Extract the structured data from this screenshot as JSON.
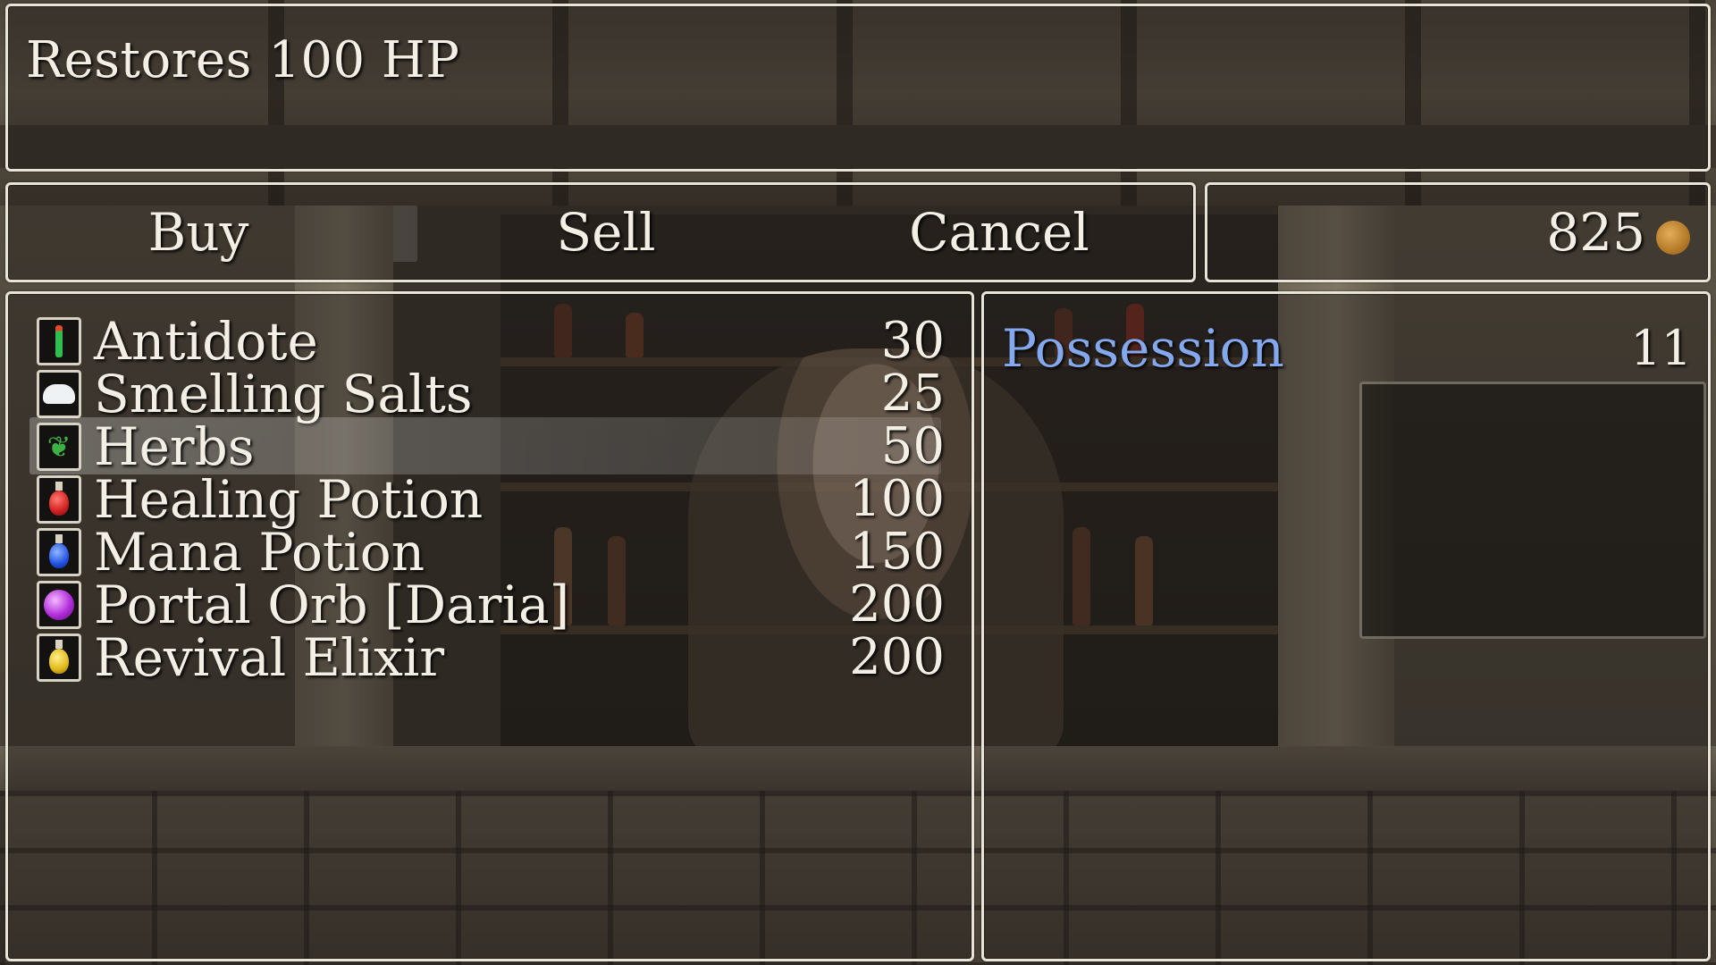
{
  "help": {
    "text": "Restores 100 HP"
  },
  "commands": [
    {
      "id": "buy",
      "label": "Buy",
      "active": true
    },
    {
      "id": "sell",
      "label": "Sell",
      "active": false
    },
    {
      "id": "cancel",
      "label": "Cancel",
      "active": false
    }
  ],
  "gold": {
    "value": "825",
    "icon": "gold-coin-icon"
  },
  "items": [
    {
      "name": "Antidote",
      "price": "30",
      "icon": "antidote-vial-icon"
    },
    {
      "name": "Smelling Salts",
      "price": "25",
      "icon": "smelling-salts-icon"
    },
    {
      "name": "Herbs",
      "price": "50",
      "icon": "herb-leaf-icon"
    },
    {
      "name": "Healing Potion",
      "price": "100",
      "icon": "red-potion-icon"
    },
    {
      "name": "Mana Potion",
      "price": "150",
      "icon": "blue-potion-icon"
    },
    {
      "name": "Portal Orb [Daria]",
      "price": "200",
      "icon": "purple-orb-icon"
    },
    {
      "name": "Revival Elixir",
      "price": "200",
      "icon": "yellow-elixir-icon"
    }
  ],
  "selected_item_index": 2,
  "status": {
    "possession_label": "Possession",
    "possession_value": "11"
  },
  "colors": {
    "system_blue": "#84a8ee",
    "window_border": "#e9e4d8",
    "text": "#f4efe4",
    "gold": "#c48a30"
  }
}
